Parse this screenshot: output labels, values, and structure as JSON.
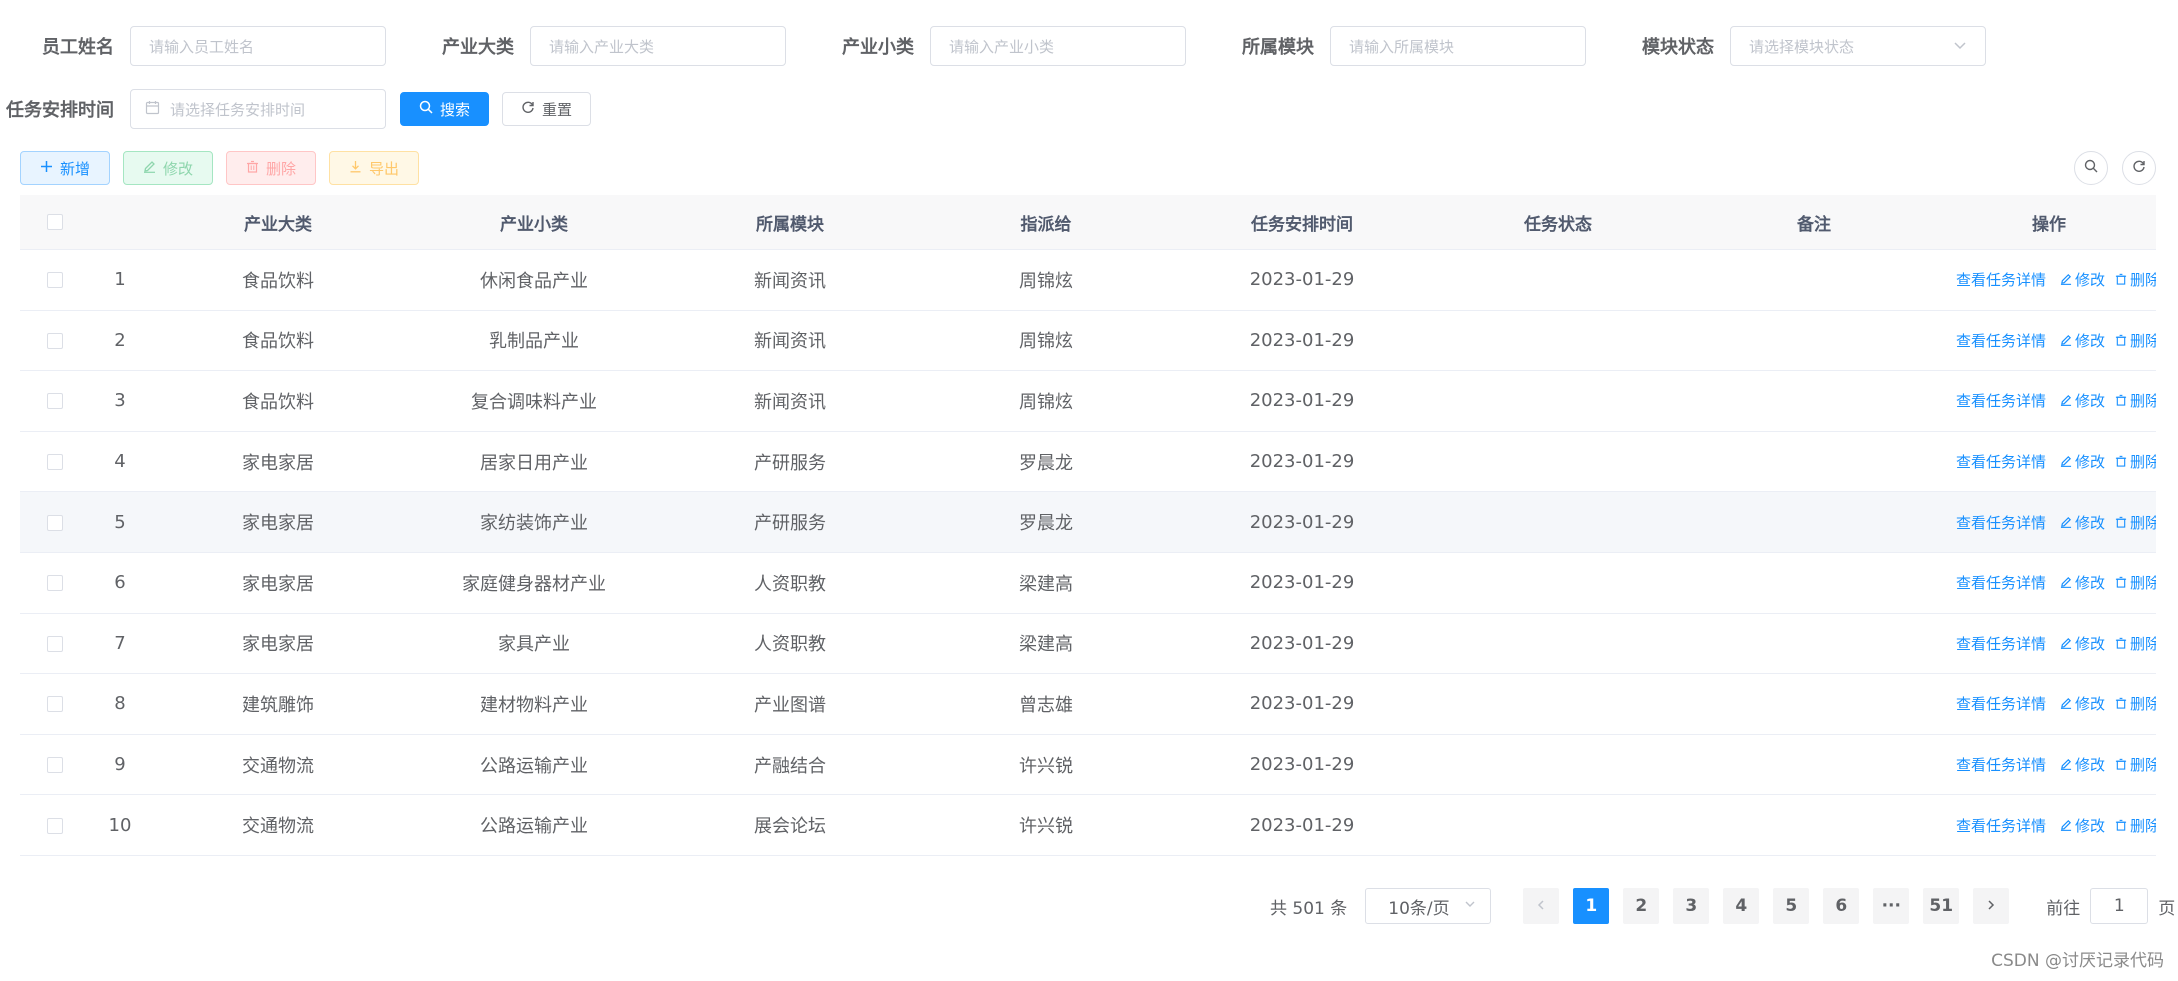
{
  "search": {
    "fields": [
      {
        "label": "员工姓名",
        "placeholder": "请输入员工姓名"
      },
      {
        "label": "产业大类",
        "placeholder": "请输入产业大类"
      },
      {
        "label": "产业小类",
        "placeholder": "请输入产业小类"
      },
      {
        "label": "所属模块",
        "placeholder": "请输入所属模块"
      },
      {
        "label": "模块状态",
        "placeholder": "请选择模块状态"
      }
    ],
    "date_label": "任务安排时间",
    "date_placeholder": "请选择任务安排时间",
    "search_button": "搜索",
    "reset_button": "重置"
  },
  "toolbar": {
    "add": "新增",
    "edit": "修改",
    "delete": "删除",
    "export": "导出"
  },
  "table": {
    "headers": [
      "产业大类",
      "产业小类",
      "所属模块",
      "指派给",
      "任务安排时间",
      "任务状态",
      "备注",
      "操作"
    ],
    "rows": [
      {
        "no": "1",
        "cat": "食品饮料",
        "sub": "休闲食品产业",
        "module": "新闻资讯",
        "assignee": "周锦炫",
        "date": "2023-01-29"
      },
      {
        "no": "2",
        "cat": "食品饮料",
        "sub": "乳制品产业",
        "module": "新闻资讯",
        "assignee": "周锦炫",
        "date": "2023-01-29"
      },
      {
        "no": "3",
        "cat": "食品饮料",
        "sub": "复合调味料产业",
        "module": "新闻资讯",
        "assignee": "周锦炫",
        "date": "2023-01-29"
      },
      {
        "no": "4",
        "cat": "家电家居",
        "sub": "居家日用产业",
        "module": "产研服务",
        "assignee": "罗晨龙",
        "date": "2023-01-29"
      },
      {
        "no": "5",
        "cat": "家电家居",
        "sub": "家纺装饰产业",
        "module": "产研服务",
        "assignee": "罗晨龙",
        "date": "2023-01-29"
      },
      {
        "no": "6",
        "cat": "家电家居",
        "sub": "家庭健身器材产业",
        "module": "人资职教",
        "assignee": "梁建高",
        "date": "2023-01-29"
      },
      {
        "no": "7",
        "cat": "家电家居",
        "sub": "家具产业",
        "module": "人资职教",
        "assignee": "梁建高",
        "date": "2023-01-29"
      },
      {
        "no": "8",
        "cat": "建筑雕饰",
        "sub": "建材物料产业",
        "module": "产业图谱",
        "assignee": "曾志雄",
        "date": "2023-01-29"
      },
      {
        "no": "9",
        "cat": "交通物流",
        "sub": "公路运输产业",
        "module": "产融结合",
        "assignee": "许兴锐",
        "date": "2023-01-29"
      },
      {
        "no": "10",
        "cat": "交通物流",
        "sub": "公路运输产业",
        "module": "展会论坛",
        "assignee": "许兴锐",
        "date": "2023-01-29"
      }
    ],
    "ops": {
      "detail": "查看任务详情",
      "edit": "修改",
      "delete": "删除"
    }
  },
  "pagination": {
    "total": "共 501 条",
    "page_size": "10条/页",
    "pages": [
      "1",
      "2",
      "3",
      "4",
      "5",
      "6"
    ],
    "ellipsis": "···",
    "last": "51",
    "goto_prefix": "前往",
    "goto_value": "1",
    "goto_suffix": "页"
  },
  "watermark": "CSDN @讨厌记录代码"
}
